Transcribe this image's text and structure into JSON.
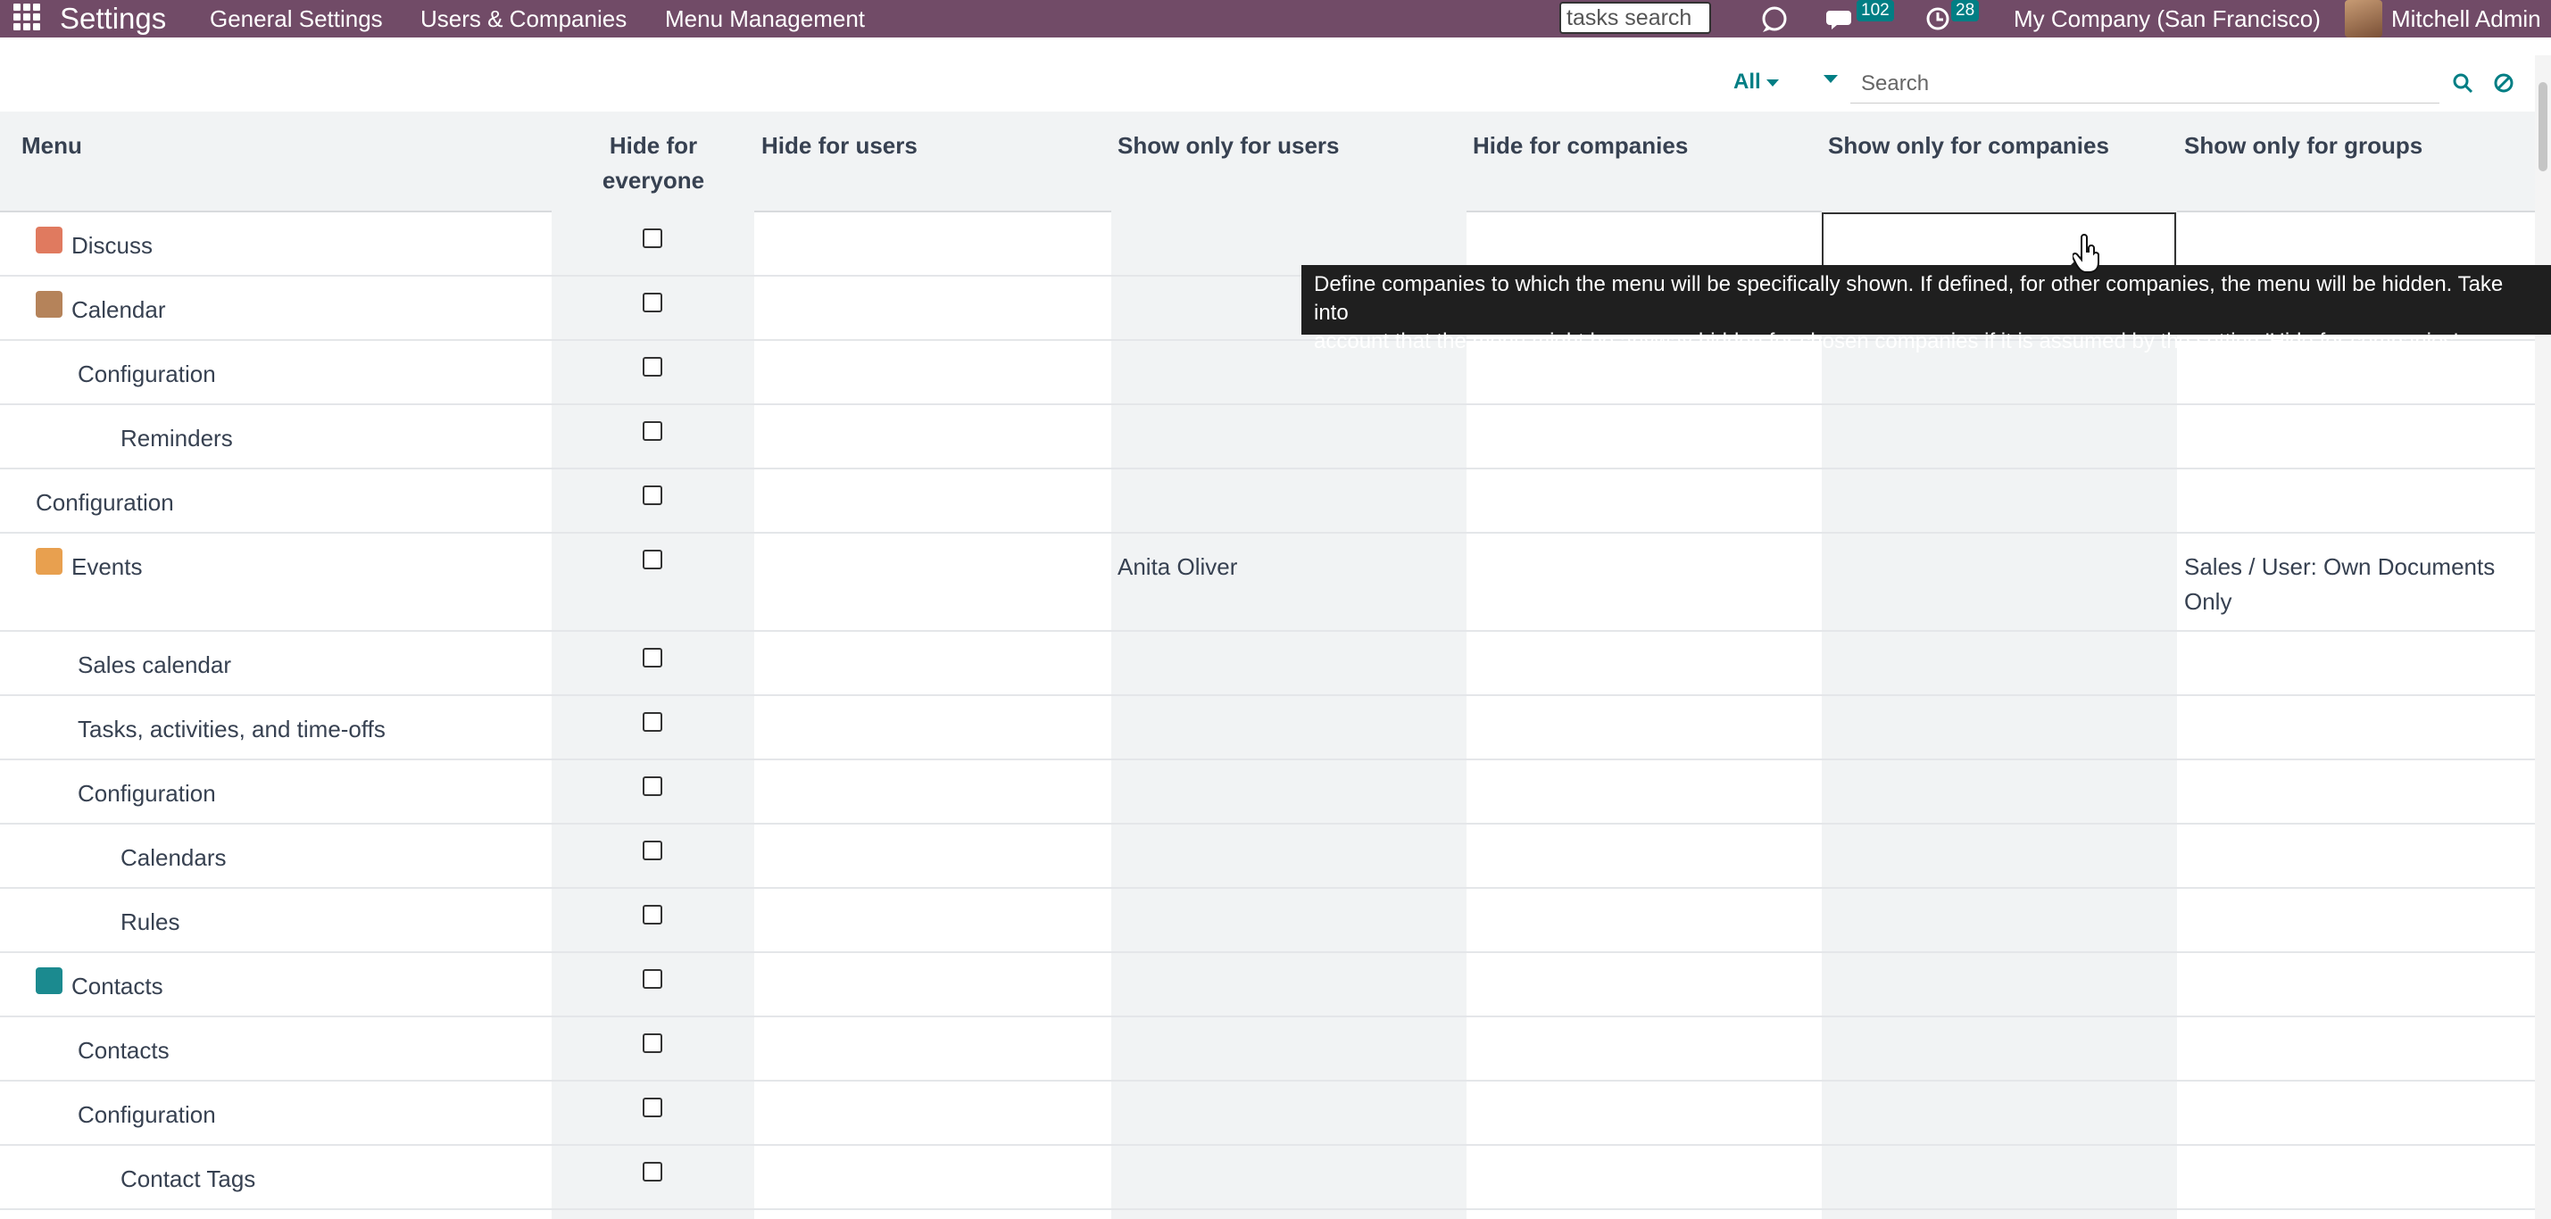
{
  "navbar": {
    "brand": "Settings",
    "menus": [
      "General Settings",
      "Users & Companies",
      "Menu Management"
    ],
    "quick_search": "tasks search",
    "messages_count": "102",
    "activities_count": "28",
    "company": "My Company (San Francisco)",
    "user": "Mitchell Admin",
    "color": "#714B67"
  },
  "control_panel": {
    "filter_label": "All",
    "search_placeholder": "Search"
  },
  "table": {
    "headers": {
      "menu": "Menu",
      "hide_everyone": "Hide for everyone",
      "hide_users": "Hide for users",
      "show_users": "Show only for users",
      "hide_companies": "Hide for companies",
      "show_companies": "Show only for companies",
      "show_groups": "Show only for groups"
    },
    "rows": [
      {
        "name": "Discuss",
        "icon": "discuss-icon",
        "level": 0,
        "show_users": "",
        "show_groups": ""
      },
      {
        "name": "Calendar",
        "icon": "calendar-icon",
        "level": 0,
        "show_users": "",
        "show_groups": ""
      },
      {
        "name": "Configuration",
        "icon": "",
        "level": 1,
        "show_users": "",
        "show_groups": ""
      },
      {
        "name": "Reminders",
        "icon": "",
        "level": 2,
        "show_users": "",
        "show_groups": ""
      },
      {
        "name": "Configuration",
        "icon": "",
        "level": 0,
        "show_users": "",
        "show_groups": ""
      },
      {
        "name": "Events",
        "icon": "events-icon",
        "level": 0,
        "show_users": "Anita Oliver",
        "show_groups": "Sales / User: Own Documents Only"
      },
      {
        "name": "Sales calendar",
        "icon": "",
        "level": 1,
        "show_users": "",
        "show_groups": ""
      },
      {
        "name": "Tasks, activities, and time-offs",
        "icon": "",
        "level": 1,
        "show_users": "",
        "show_groups": ""
      },
      {
        "name": "Configuration",
        "icon": "",
        "level": 1,
        "show_users": "",
        "show_groups": ""
      },
      {
        "name": "Calendars",
        "icon": "",
        "level": 2,
        "show_users": "",
        "show_groups": ""
      },
      {
        "name": "Rules",
        "icon": "",
        "level": 2,
        "show_users": "",
        "show_groups": ""
      },
      {
        "name": "Contacts",
        "icon": "contacts-icon",
        "level": 0,
        "show_users": "",
        "show_groups": ""
      },
      {
        "name": "Contacts",
        "icon": "",
        "level": 1,
        "show_users": "",
        "show_groups": ""
      },
      {
        "name": "Configuration",
        "icon": "",
        "level": 1,
        "show_users": "",
        "show_groups": ""
      },
      {
        "name": "Contact Tags",
        "icon": "",
        "level": 2,
        "show_users": "",
        "show_groups": ""
      }
    ]
  },
  "tooltip": {
    "line1": "Define companies to which the menu will be specifically shown. If defined, for other companies, the menu will be hidden. Take into",
    "line2": "account that the menu might be anyway hidden for chosen companies if it is assumed by the setting 'Hide for companies'"
  }
}
